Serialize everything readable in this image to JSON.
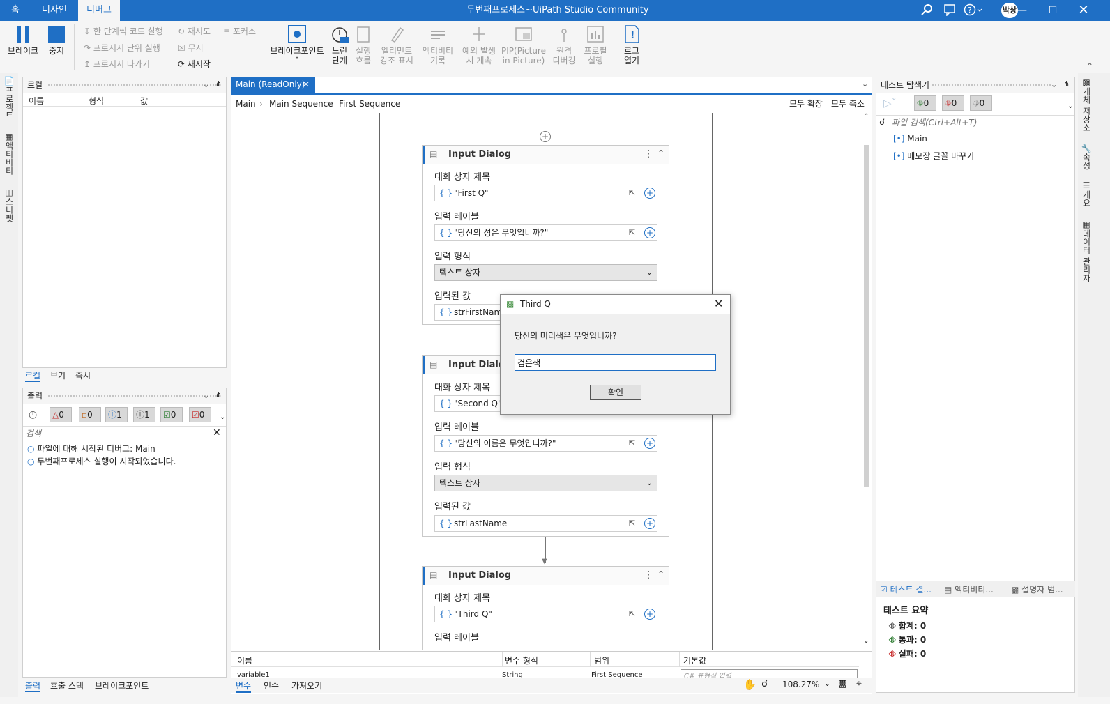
{
  "titlebar": {
    "tabs": [
      "홈",
      "디자인",
      "디버그"
    ],
    "title": "두번째프로세스~UiPath Studio Community",
    "user": "박상"
  },
  "ribbon": {
    "break": "브레이크",
    "stop": "중지",
    "step_into": "한 단계씩 코드 실행",
    "step_over": "프로시저 단위 실행",
    "step_out": "프로시저 나가기",
    "retry": "재시도",
    "ignore": "무시",
    "restart": "재시작",
    "focus": "포커스",
    "breakpoints": "브레이크포인트",
    "slow_step": [
      "느린",
      "단계"
    ],
    "execution_trail": [
      "실행",
      "흐름"
    ],
    "highlight": [
      "엘리먼트",
      "강조 표시"
    ],
    "log_activities": [
      "액티비티",
      "기록"
    ],
    "continue_on_exception": [
      "예외 발생",
      "시 계속"
    ],
    "pip": [
      "PIP(Picture",
      "in Picture)"
    ],
    "remote_debug": [
      "원격",
      "디버깅"
    ],
    "profile": [
      "프로필",
      "실행"
    ],
    "open_logs": [
      "로그",
      "열기"
    ]
  },
  "left_strip": [
    "프로젝트",
    "액티비티",
    "스니펫"
  ],
  "right_strip": [
    "개체 저장소",
    "속성",
    "개요",
    "데이터 관리자"
  ],
  "locals": {
    "title": "로컬",
    "columns": [
      "이름",
      "형식",
      "값"
    ],
    "tabs": [
      "로컬",
      "보기",
      "즉시"
    ]
  },
  "output": {
    "title": "출력",
    "counts": [
      "0",
      "0",
      "1",
      "1",
      "0",
      "0"
    ],
    "search_placeholder": "검색",
    "lines": [
      "파일에 대해 시작된 디버그: Main",
      "두번째프로세스 실행이 시작되었습니다."
    ],
    "tabs": [
      "출력",
      "호출 스택",
      "브레이크포인트"
    ]
  },
  "designer": {
    "doc_tab": "Main (ReadOnly)",
    "breadcrumb": [
      "Main",
      "Main Sequence",
      "First Sequence"
    ],
    "expand_all": "모두 확장",
    "collapse_all": "모두 축소",
    "activities": [
      {
        "title": "Input Dialog",
        "label_title": "대화 상자 제목",
        "title_value": "\"First Q\"",
        "label_prompt": "입력 레이블",
        "prompt_value": "\"당신의 성은 무엇입니까?\"",
        "label_type": "입력 형식",
        "type_value": "텍스트 상자",
        "label_result": "입력된 값",
        "result_value": "strFirstName"
      },
      {
        "title": "Input Dialog",
        "label_title": "대화 상자 제목",
        "title_value": "\"Second Q\"",
        "label_prompt": "입력 레이블",
        "prompt_value": "\"당신의 이름은 무엇입니까?\"",
        "label_type": "입력 형식",
        "type_value": "텍스트 상자",
        "label_result": "입력된 값",
        "result_value": "strLastName"
      },
      {
        "title": "Input Dialog",
        "label_title": "대화 상자 제목",
        "title_value": "\"Third Q\"",
        "label_prompt": "입력 레이블"
      }
    ],
    "variables_columns": [
      "이름",
      "변수 형식",
      "범위",
      "기본값"
    ],
    "variables_row": [
      "variable1",
      "String",
      "First Sequence",
      "C# 표현식 입력"
    ],
    "bottom_tabs": [
      "변수",
      "인수",
      "가져오기"
    ],
    "zoom": "108.27%"
  },
  "dialog": {
    "title": "Third Q",
    "prompt": "당신의 머리색은 무엇입니까?",
    "value": "검은색",
    "ok": "확인"
  },
  "test_explorer": {
    "title": "테스트 탐색기",
    "counts": [
      "0",
      "0",
      "0"
    ],
    "search_placeholder": "파일 검색(Ctrl+Alt+T)",
    "items": [
      "Main",
      "메모장 글꼴 바꾸기"
    ],
    "bottom_tabs": [
      "테스트 결...",
      "액티비티...",
      "설명자 범..."
    ],
    "summary_title": "테스트 요약",
    "summary": [
      "합계: 0",
      "통과: 0",
      "실패: 0"
    ]
  },
  "colors": {
    "accent": "#1f6fc5",
    "title_bar": "#1f6fc5"
  }
}
